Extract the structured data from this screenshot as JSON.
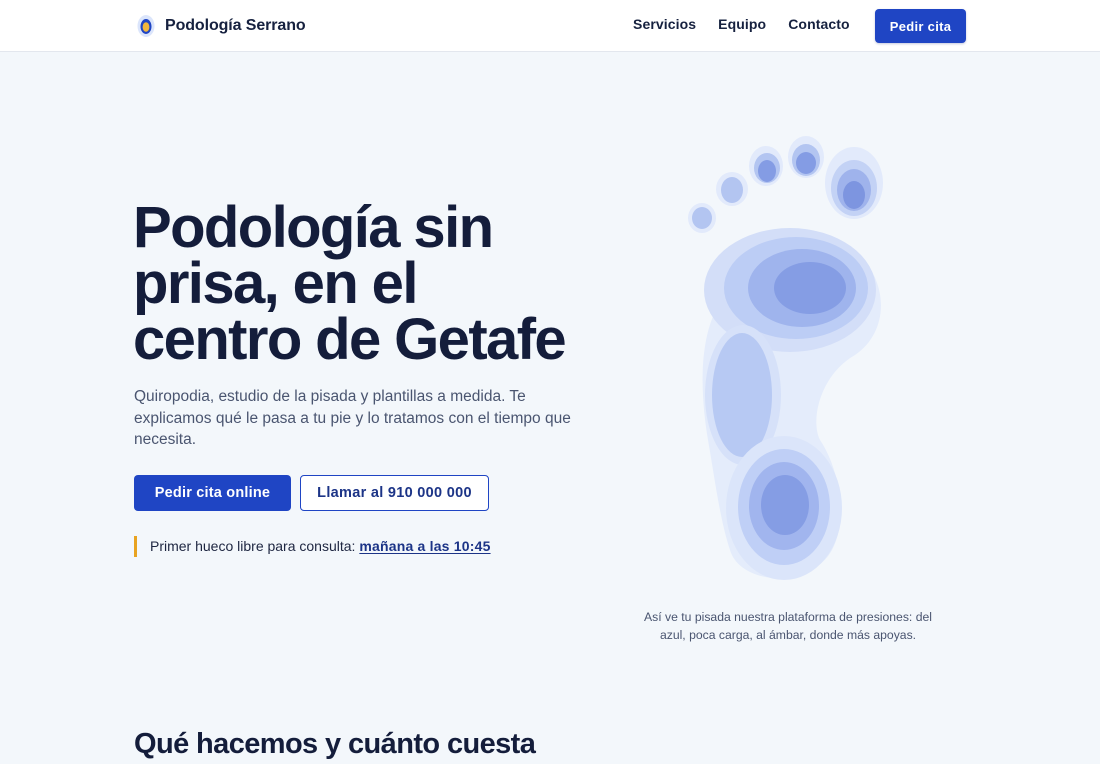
{
  "brand": {
    "name": "Podología Serrano",
    "logo_icon": "footprint-logo-icon",
    "accent_color": "#1f45c4"
  },
  "nav": {
    "items": [
      "Servicios",
      "Equipo",
      "Contacto"
    ],
    "cta_label": "Pedir cita"
  },
  "hero": {
    "title_lines": [
      "Podología sin",
      "prisa, en el",
      "centro de Getafe"
    ],
    "subtitle": "Quiropodia, estudio de la pisada y plantillas a medida. Te explicamos qué le pasa a tu pie y lo tratamos con el tiempo que necesita.",
    "primary_button": "Pedir cita online",
    "secondary_button": "Llamar al 910 000 000",
    "next_slot_label": "Primer hueco libre para consulta:",
    "next_slot_link": "mañana a las 10:45"
  },
  "pressure_map": {
    "icon": "foot-pressure-map-icon",
    "caption": "Así ve tu pisada nuestra plataforma de presiones: del azul, poca carga, al ámbar, donde más apoyas.",
    "colors": {
      "low": "#dfe8fb",
      "mid": "#b9cbf4",
      "high": "#94aaea",
      "peak": "#7a92e0"
    }
  },
  "section": {
    "title": "Qué hacemos y cuánto cuesta"
  }
}
